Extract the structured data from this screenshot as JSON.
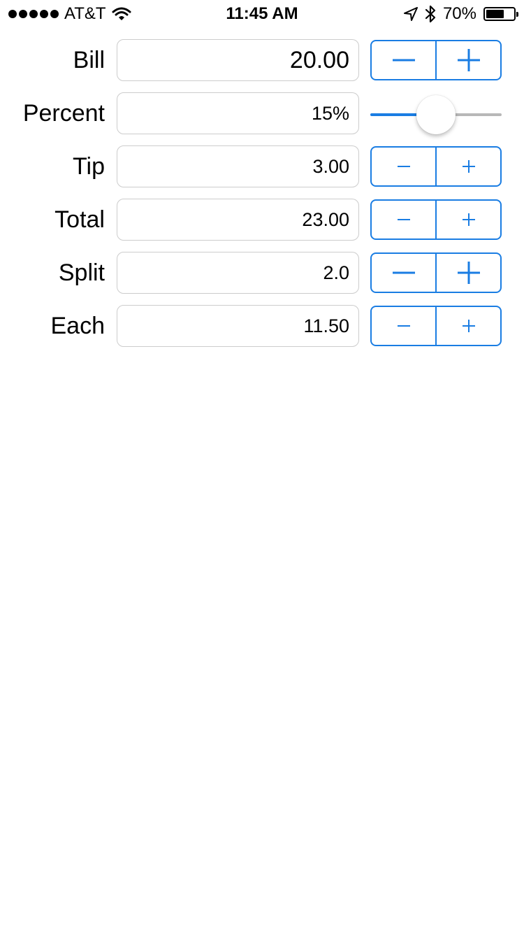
{
  "status_bar": {
    "carrier": "AT&T",
    "time": "11:45 AM",
    "battery_percent": "70%",
    "battery_level": 0.7
  },
  "accent_color": "#1a7de3",
  "rows": [
    {
      "label": "Bill",
      "value": "20.00"
    },
    {
      "label": "Percent",
      "value": "15%"
    },
    {
      "label": "Tip",
      "value": "3.00"
    },
    {
      "label": "Total",
      "value": "23.00"
    },
    {
      "label": "Split",
      "value": "2.0"
    },
    {
      "label": "Each",
      "value": "11.50"
    }
  ],
  "percent_slider": {
    "level": 0.5
  },
  "icons": {
    "minus": "minus-icon",
    "plus": "plus-icon",
    "wifi": "wifi-icon",
    "location": "location-arrow-icon",
    "bluetooth": "bluetooth-icon",
    "battery": "battery-icon"
  }
}
